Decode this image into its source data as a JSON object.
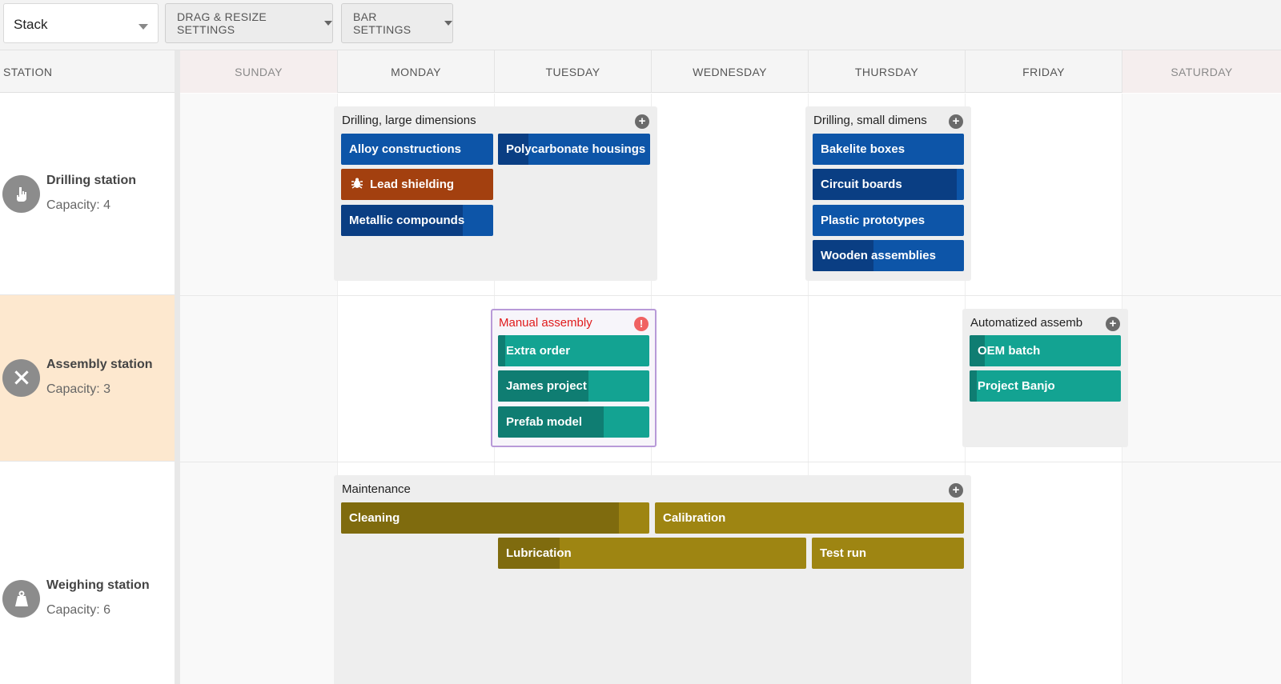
{
  "toolbar": {
    "layout_select": "Stack",
    "drag_resize_label": "DRAG & RESIZE SETTINGS",
    "bar_settings_label": "BAR SETTINGS"
  },
  "header": {
    "station_label": "STATION",
    "days": [
      "SUNDAY",
      "MONDAY",
      "TUESDAY",
      "WEDNESDAY",
      "THURSDAY",
      "FRIDAY",
      "SATURDAY"
    ]
  },
  "stations": [
    {
      "name": "Drilling station",
      "capacity": "Capacity: 4",
      "icon": "hand-pointer-icon"
    },
    {
      "name": "Assembly station",
      "capacity": "Capacity: 3",
      "icon": "tools-icon"
    },
    {
      "name": "Weighing station",
      "capacity": "Capacity: 6",
      "icon": "weight-icon"
    }
  ],
  "groups": {
    "drilling_large": {
      "title": "Drilling, large dimensions",
      "events": [
        {
          "name": "Alloy constructions",
          "progress": 0.0
        },
        {
          "name": "Polycarbonate housings",
          "progress": 0.2
        },
        {
          "name": "Lead shielding",
          "progress": 0.0,
          "icon": "bug-icon"
        },
        {
          "name": "Metallic compounds",
          "progress": 0.8
        }
      ]
    },
    "drilling_small": {
      "title": "Drilling, small dimens",
      "events": [
        {
          "name": "Bakelite boxes",
          "progress": 0.0
        },
        {
          "name": "Circuit boards",
          "progress": 0.95
        },
        {
          "name": "Plastic prototypes",
          "progress": 0.0
        },
        {
          "name": "Wooden assemblies",
          "progress": 0.4
        }
      ]
    },
    "manual_assembly": {
      "title": "Manual assembly",
      "status": "alert",
      "events": [
        {
          "name": "Extra order",
          "progress": 0.05
        },
        {
          "name": "James project",
          "progress": 0.6
        },
        {
          "name": "Prefab model",
          "progress": 0.7
        }
      ]
    },
    "automatized_assembly": {
      "title": "Automatized assemb",
      "events": [
        {
          "name": "OEM batch",
          "progress": 0.1
        },
        {
          "name": "Project Banjo",
          "progress": 0.05
        }
      ]
    },
    "maintenance": {
      "title": "Maintenance",
      "events": [
        {
          "name": "Cleaning",
          "progress": 0.9
        },
        {
          "name": "Calibration",
          "progress": 0.0
        },
        {
          "name": "Lubrication",
          "progress": 0.2
        },
        {
          "name": "Test run",
          "progress": 0.0
        }
      ]
    }
  },
  "colors": {
    "accent_blue": "#0d55a8",
    "rust": "#a3400f",
    "teal": "#13a392",
    "olive": "#9e8512",
    "alert_red": "#e01b1b",
    "highlight_row": "#fde8cf"
  }
}
